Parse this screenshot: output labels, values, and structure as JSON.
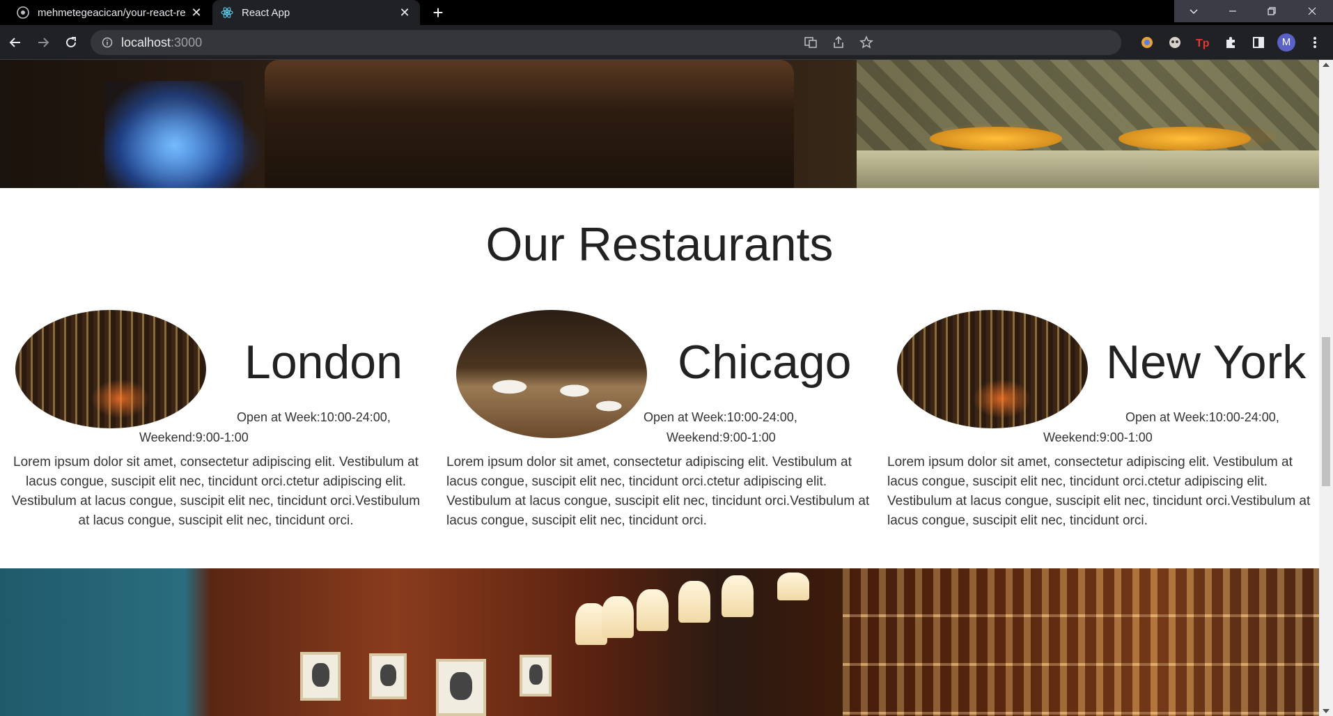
{
  "browser": {
    "tabs": [
      {
        "title": "mehmetegeacican/your-react-re",
        "active": false
      },
      {
        "title": "React App",
        "active": true
      }
    ],
    "new_tab_symbol": "+",
    "url_host": "localhost",
    "url_port": ":3000",
    "profile_initial": "M"
  },
  "page": {
    "section_title": "Our Restaurants",
    "restaurants": [
      {
        "city": "London",
        "hours_line1": "Open at Week:10:00-24:00,",
        "hours_line2": "Weekend:9:00-1:00",
        "description": "Lorem ipsum dolor sit amet, consectetur adipiscing elit. Vestibulum at lacus congue, suscipit elit nec, tincidunt orci.ctetur adipiscing elit. Vestibulum at lacus congue, suscipit elit nec, tincidunt orci.Vestibulum at lacus congue, suscipit elit nec, tincidunt orci."
      },
      {
        "city": "Chicago",
        "hours_line1": "Open at Week:10:00-24:00,",
        "hours_line2": "Weekend:9:00-1:00",
        "description": "Lorem ipsum dolor sit amet, consectetur adipiscing elit. Vestibulum at lacus congue, suscipit elit nec, tincidunt orci.ctetur adipiscing elit. Vestibulum at lacus congue, suscipit elit nec, tincidunt orci.Vestibulum at lacus congue, suscipit elit nec, tincidunt orci."
      },
      {
        "city": "New York",
        "hours_line1": "Open at Week:10:00-24:00,",
        "hours_line2": "Weekend:9:00-1:00",
        "description": "Lorem ipsum dolor sit amet, consectetur adipiscing elit. Vestibulum at lacus congue, suscipit elit nec, tincidunt orci.ctetur adipiscing elit. Vestibulum at lacus congue, suscipit elit nec, tincidunt orci.Vestibulum at lacus congue, suscipit elit nec, tincidunt orci."
      }
    ]
  }
}
